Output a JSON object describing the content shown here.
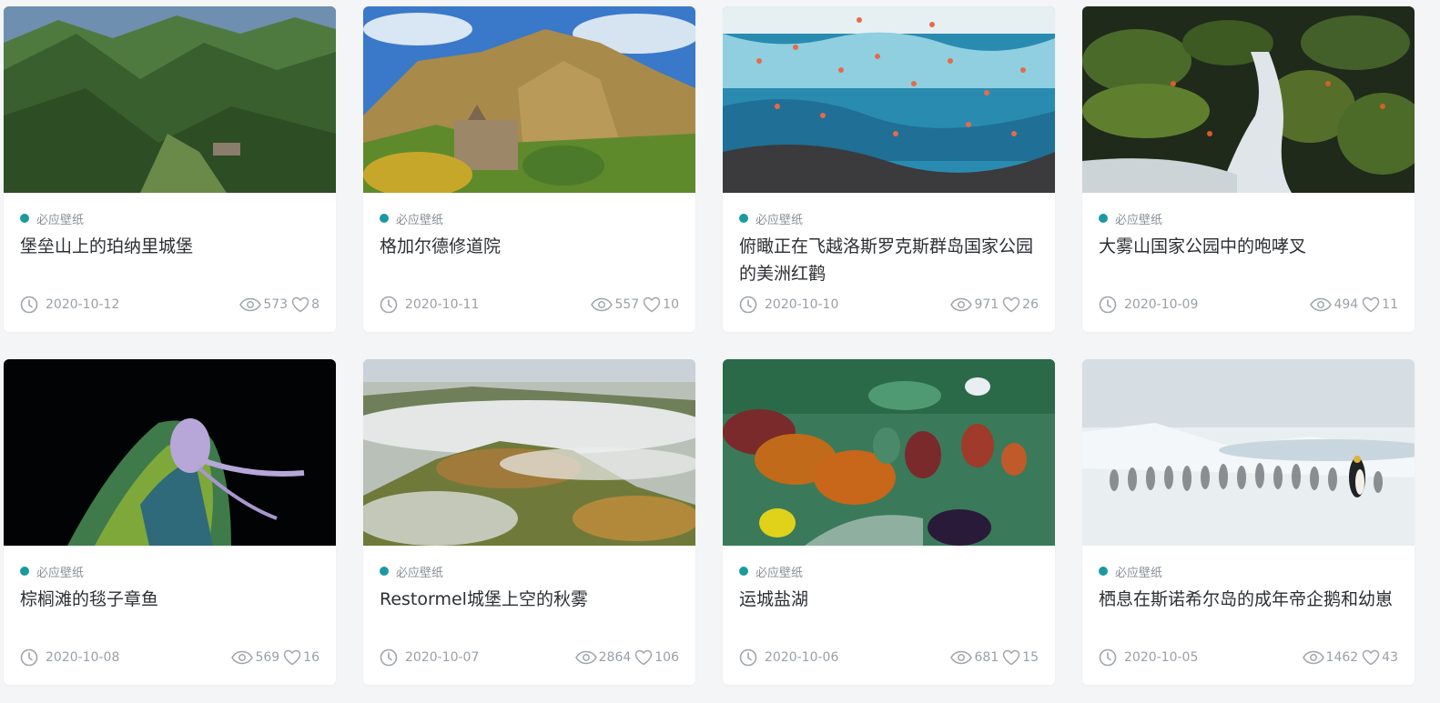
{
  "accent_color": "#1a9a9f",
  "cards": [
    {
      "category": "必应壁纸",
      "title": "堡垒山上的珀纳里城堡",
      "date": "2020-10-12",
      "views": "573",
      "likes": "8",
      "image": "mountain-valley-castle"
    },
    {
      "category": "必应壁纸",
      "title": "格加尔德修道院",
      "date": "2020-10-11",
      "views": "557",
      "likes": "10",
      "image": "monastery-cliffs"
    },
    {
      "category": "必应壁纸",
      "title": "俯瞰正在飞越洛斯罗克斯群岛国家公园的美洲红鹳",
      "date": "2020-10-10",
      "views": "971",
      "likes": "26",
      "image": "flamingos-over-sea"
    },
    {
      "category": "必应壁纸",
      "title": "大雾山国家公园中的咆哮叉",
      "date": "2020-10-09",
      "views": "494",
      "likes": "11",
      "image": "mossy-stream"
    },
    {
      "category": "必应壁纸",
      "title": "棕榈滩的毯子章鱼",
      "date": "2020-10-08",
      "views": "569",
      "likes": "16",
      "image": "blanket-octopus"
    },
    {
      "category": "必应壁纸",
      "title": "Restormel城堡上空的秋雾",
      "date": "2020-10-07",
      "views": "2864",
      "likes": "106",
      "image": "misty-hills"
    },
    {
      "category": "必应壁纸",
      "title": "运城盐湖",
      "date": "2020-10-06",
      "views": "681",
      "likes": "15",
      "image": "salt-lake-aerial"
    },
    {
      "category": "必应壁纸",
      "title": "栖息在斯诺希尔岛的成年帝企鹅和幼崽",
      "date": "2020-10-05",
      "views": "1462",
      "likes": "43",
      "image": "emperor-penguins"
    }
  ]
}
